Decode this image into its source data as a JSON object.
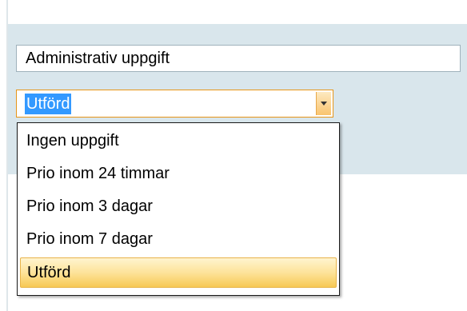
{
  "form": {
    "task_title": "Administrativ uppgift",
    "status_value": "Utförd"
  },
  "dropdown": {
    "options": [
      {
        "label": "Ingen uppgift"
      },
      {
        "label": "Prio inom 24 timmar"
      },
      {
        "label": "Prio inom 3 dagar"
      },
      {
        "label": "Prio inom 7 dagar"
      },
      {
        "label": "Utförd"
      }
    ],
    "selected_index": 4
  },
  "colors": {
    "panel_background": "#d9e6ec",
    "focus_border": "#e69518",
    "selection_highlight": "#3399ff",
    "selected_option": "#fde39a"
  },
  "icons": {
    "dropdown_arrow": "chevron-down-icon"
  }
}
